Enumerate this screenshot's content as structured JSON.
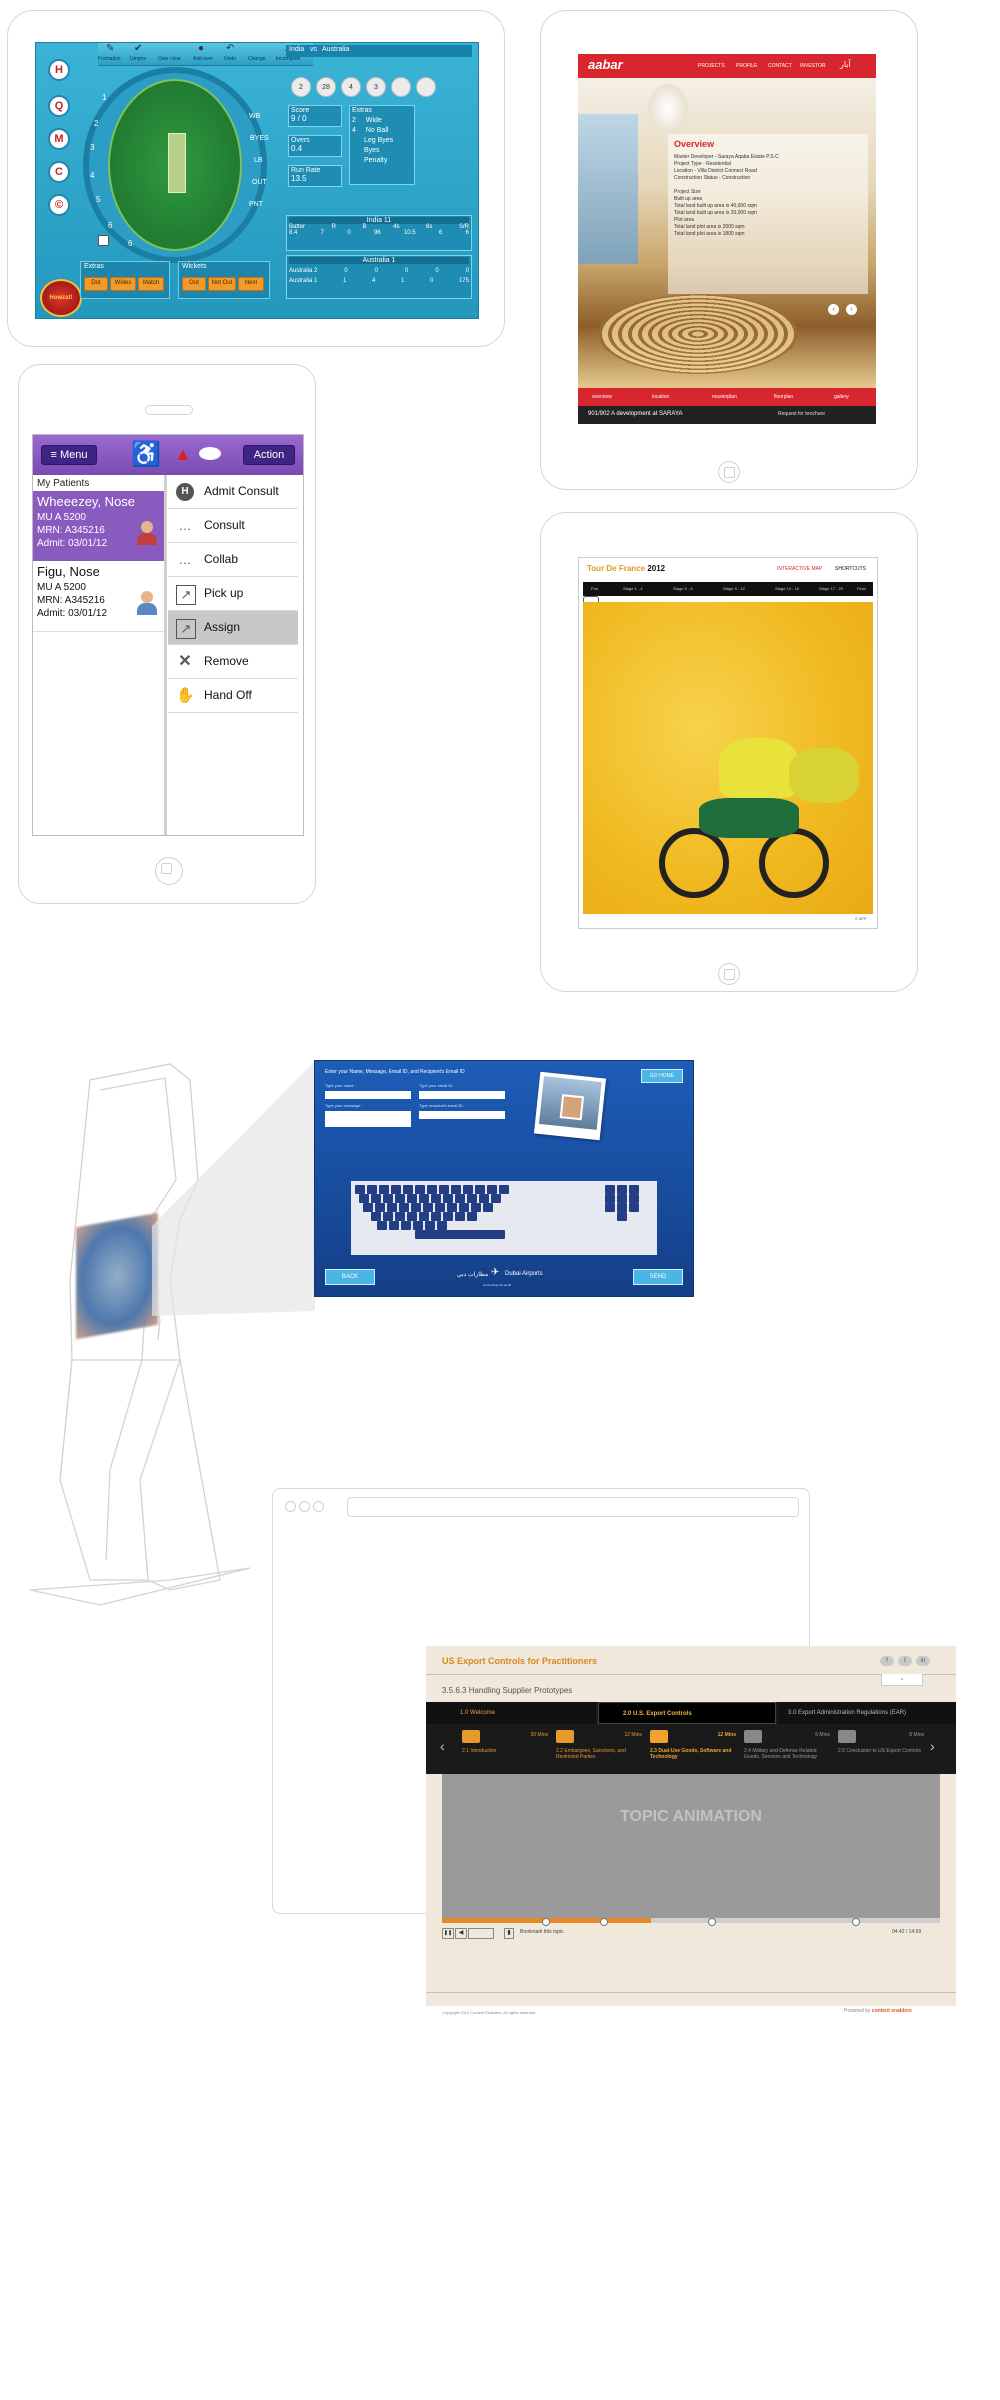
{
  "cricket": {
    "teams": [
      "India",
      "vs",
      "Australia"
    ],
    "toolbar": [
      "Formation",
      "Umpire",
      "Over clear",
      "Add over",
      "Undo",
      "Change",
      "Incomplete"
    ],
    "side_icons": [
      "H",
      "Q",
      "M",
      "C",
      "©"
    ],
    "field_positions": [
      "1",
      "2",
      "3",
      "4",
      "5",
      "6"
    ],
    "right_labels": [
      "WB",
      "BYES",
      "LB",
      "OUT",
      "PNT"
    ],
    "field_bottom": "6",
    "logo": "Howzat!",
    "extras_btns": [
      "Dot",
      "Wides",
      "Match"
    ],
    "wickets_btns": [
      "Out",
      "Not Out",
      "Next"
    ],
    "extras_title": "Extras",
    "wickets_title": "Wickets",
    "balls": [
      "2",
      "28",
      "4",
      "3",
      "",
      ""
    ],
    "score_box_labels": [
      "Score",
      "Overs",
      "Run Rate"
    ],
    "score_values": [
      "9 / 0",
      "0.4",
      "13.5"
    ],
    "extras_header": "Extras",
    "extras_list": [
      [
        "2",
        "Wide"
      ],
      [
        "4",
        "No Ball"
      ],
      [
        "",
        "Leg Byes"
      ],
      [
        "",
        "Byes"
      ],
      [
        "",
        "Penalty"
      ]
    ],
    "batting_title": "India 11",
    "batting_header": [
      "Batter",
      "R",
      "B",
      "4s",
      "6s",
      "S/R"
    ],
    "batting_row": [
      "8.4",
      "7",
      "0",
      "96",
      "10.5",
      "6",
      "6"
    ],
    "bowling_title": "Australia 1",
    "bowlers": [
      "Australia 2",
      "Australia 1"
    ],
    "bowler_vals": [
      [
        "0",
        "0",
        "0",
        "0",
        "0"
      ],
      [
        "1",
        "4",
        "1",
        "0",
        "175"
      ]
    ]
  },
  "aabar": {
    "logo": "aabar",
    "nav": [
      "PROJECTS",
      "PROFILE",
      "CONTACT",
      "INVESTOR"
    ],
    "arabic": "آبار",
    "overview_title": "Overview",
    "overview_lines": [
      "Master Developer - Saraya Aqaba Estate P.S.C",
      "Project Type - Residential",
      "Location - Villa District Connect Road",
      "Construction Status - Construction",
      "",
      "Project Size",
      "Built up area",
      "Total land built up area is 40,000 sqm",
      "Total land built up area is 20,000 sqm",
      "Plot area",
      "Total land plot area is 2000 sqm",
      "Total land plot area is 1800 sqm"
    ],
    "bottom_nav": [
      "overview",
      "location",
      "masterplan",
      "floorplan",
      "gallery"
    ],
    "footer_left": "901/902 A development at SARAYA",
    "footer_right": "Request for brochure"
  },
  "medical": {
    "menu_label": "≡ Menu",
    "action_label": "Action",
    "list_title": "My Patients",
    "patients": [
      {
        "name": "Wheeezey, Nose",
        "unit": "MU A 5200",
        "mrn": "MRN: A345216",
        "admit": "Admit:  03/01/12"
      },
      {
        "name": "Figu, Nose",
        "unit": "MU A 5200",
        "mrn": "MRN: A345216",
        "admit": "Admit:  03/01/12"
      }
    ],
    "actions": [
      {
        "icon": "H",
        "label": "Admit Consult"
      },
      {
        "icon": "…",
        "label": "Consult"
      },
      {
        "icon": "…",
        "label": "Collab"
      },
      {
        "icon": "↗",
        "label": "Pick up"
      },
      {
        "icon": "↗",
        "label": "Assign"
      },
      {
        "icon": "✕",
        "label": "Remove"
      },
      {
        "icon": "✋",
        "label": "Hand Off"
      }
    ]
  },
  "tour": {
    "title_prefix": "Tour De France",
    "year": "2012",
    "nav": [
      "INTERACTIVE MAP",
      "SHORTCUTS"
    ],
    "stages": [
      "Prol",
      "Stage 1 - 4",
      "Stage 5 - 8",
      "Stage 9 - 12",
      "Stage 13 - 16",
      "Stage 17 - 20",
      "Final"
    ],
    "credit": "© AFP"
  },
  "kiosk": {
    "instruction": "Enter your Name, Message, Email ID, and Recipient's Email ID",
    "labels": [
      "Type your name :",
      "Type your email ID :",
      "Type your message :",
      "Type recipient's email ID :"
    ],
    "go_home": "GO HOME",
    "back": "BACK",
    "send": "SEND",
    "brand": "Dubai Airports",
    "arabic": "مطارات دبي",
    "sub": "Connecting the world"
  },
  "elearn": {
    "course_title": "US Export Controls for Practitioners",
    "topic": "3.5.6.3 Handling Supplier Prototypes",
    "tabs": [
      "1.0 Welcome",
      "2.0 U.S. Export Controls",
      "3.0 Export Administration Regulations (EAR)"
    ],
    "lessons": [
      {
        "title": "2.1 Introduction",
        "mins": "30 Mins"
      },
      {
        "title": "2.2 Embargoes, Sanctions, and Restricted Parties",
        "mins": "12 Mins"
      },
      {
        "title": "2.3 Dual-Use Goods, Software and Technology",
        "mins": "12 Mins"
      },
      {
        "title": "2.4 Military and Defense Related Goods, Services and Technology",
        "mins": "5 Mins"
      },
      {
        "title": "2.5 Conclusion to US Export Controls",
        "mins": "8 Mins"
      }
    ],
    "placeholder": "TOPIC ANIMATION",
    "bookmark": "Bookmark this topic",
    "time": "04:42 / 14:59",
    "progress": 0.42,
    "copyright": "Copyright 2012 Content Enablers. All rights reserved.",
    "powered": "Powered by",
    "brand": "content enablers"
  },
  "colors": {
    "cricket_bg": "#2aa6cc",
    "aabar_red": "#d7262e",
    "medical_purple": "#8a5bbf",
    "tour_yellow": "#f2c228",
    "kiosk_blue": "#1b4d9b",
    "elearn_orange": "#e5972c"
  }
}
